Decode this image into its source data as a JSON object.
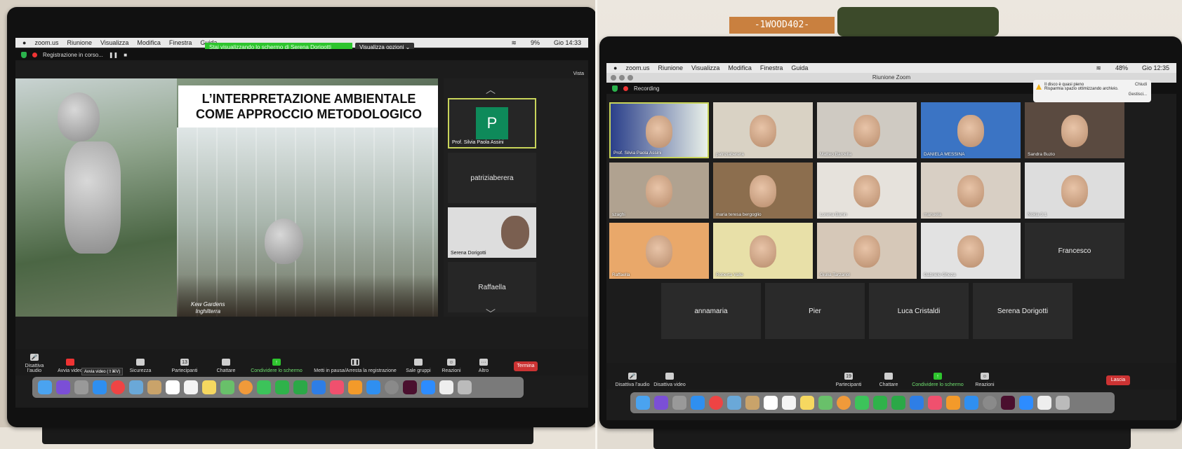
{
  "left": {
    "menubar": {
      "app": "zoom.us",
      "items": [
        "Riunione",
        "Visualizza",
        "Modifica",
        "Finestra",
        "Guida"
      ],
      "battery": "9%",
      "clock": "Gio 14:33"
    },
    "sharing_banner": "Stai visualizzando lo schermo di Serena Dorigotti",
    "view_options": "Visualizza opzioni ⌄",
    "recording": "Registrazione in corso...",
    "vista": "Vista",
    "slide": {
      "title_line1": "L’INTERPRETAZIONE AMBIENTALE",
      "title_line2": "COME APPROCCIO METODOLOGICO",
      "caption_line1": "Kew Gardens",
      "caption_line2": "Inghilterra"
    },
    "sidebar": {
      "tiles": [
        {
          "letter": "P",
          "name": "Prof. Silvia Paola Assini"
        },
        {
          "name": "patriziaberera"
        },
        {
          "name": "Serena Dorigotti"
        },
        {
          "name": "Raffaella"
        }
      ]
    },
    "toolbar": {
      "mute": "Disattiva l’audio",
      "video": "Avvia video",
      "security": "Sicurezza",
      "participants": "Partecipanti",
      "participants_count": "13",
      "chat": "Chattare",
      "share": "Condividere lo schermo",
      "record": "Metti in pausa/Arresta la registrazione",
      "rooms": "Sale gruppi",
      "reactions": "Reazioni",
      "more": "Altro",
      "end": "Termina"
    },
    "tooltip": "Avvia video (⇧⌘V)"
  },
  "right": {
    "menubar": {
      "app": "zoom.us",
      "items": [
        "Riunione",
        "Visualizza",
        "Modifica",
        "Finestra",
        "Guida"
      ],
      "battery": "48%",
      "clock": "Gio 12:35"
    },
    "window_title": "Riunione Zoom",
    "recording": "Recording",
    "notification": {
      "line1": "Il disco è quasi pieno",
      "line2": "Risparmia spazio ottimizzando archivio.",
      "close": "Chiudi",
      "manage": "Gestisci..."
    },
    "participants": [
      "Prof. Silvia Paola Assini",
      "patriziaberera",
      "Matteo Barcella",
      "DANIELA MESSINA",
      "Sandra Buzio",
      "szaghi",
      "maria teresa bergoglio",
      "Lorena Banin",
      "manuela",
      "Nokia 3.1",
      "Raffaella",
      "Roberta Valle",
      "Giulia Tarzariol",
      "Gabriele Gheza",
      "Francesco",
      "annamaria",
      "Pier",
      "Luca Cristaldi",
      "Serena Dorigotti"
    ],
    "toolbar": {
      "mute": "Disattiva l’audio",
      "video": "Disattiva video",
      "participants": "Partecipanti",
      "participants_count": "19",
      "chat": "Chattare",
      "share": "Condividere lo schermo",
      "reactions": "Reazioni",
      "leave": "Lascia"
    }
  },
  "wall_sign": "-1WOOD402-"
}
